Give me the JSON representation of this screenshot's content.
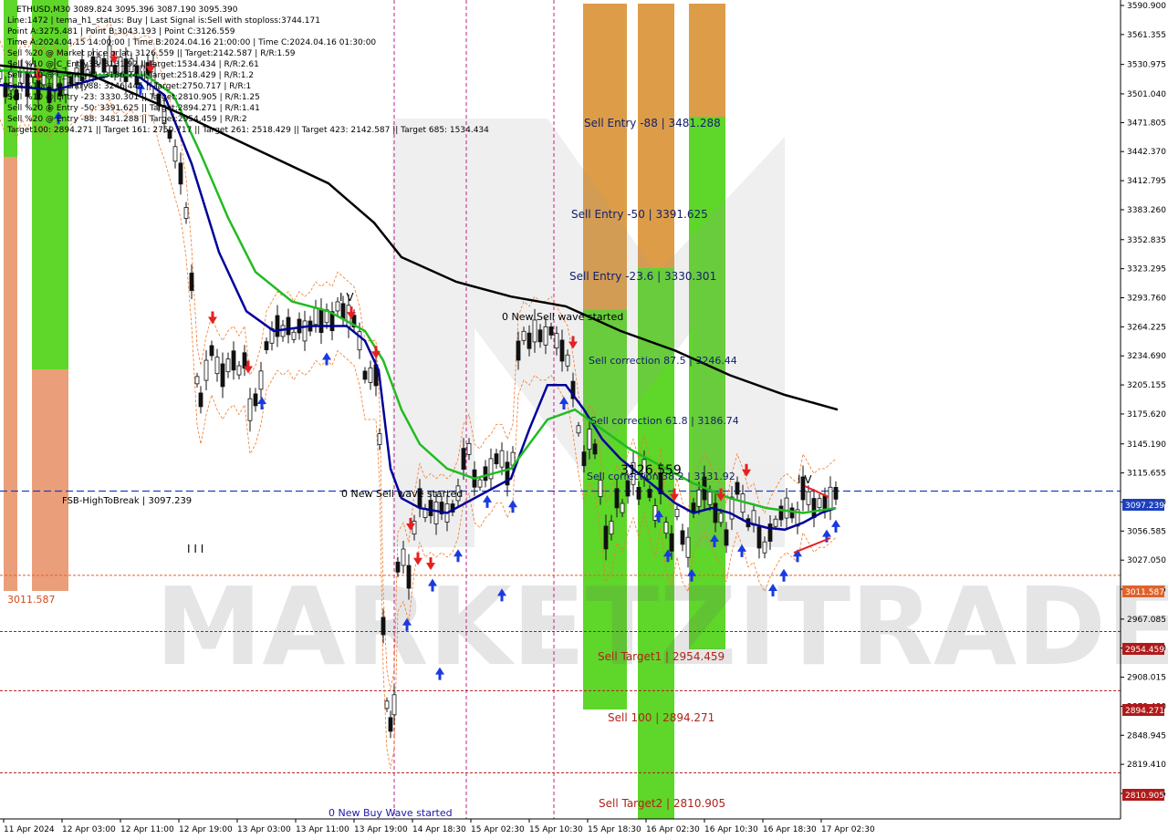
{
  "chart_data": {
    "type": "candlestick",
    "symbol_line": "ETHUSD,M30  3089.824 3095.396 3087.190 3095.390",
    "info_lines": [
      "Line:1472 | tema_h1_status: Buy | Last Signal is:Sell with stoploss:3744.171",
      "Point A:3275.481 | Point B:3043.193 | Point C:3126.559",
      "Time A:2024.04.15 14:00:00 | Time B:2024.04.16 21:00:00 | Time C:2024.04.16 01:30:00",
      "Sell %20 @ Market price or at: 3126.559 || Target:2142.587 | R/R:1.59",
      "Sell %10 @ C_Entry38: 3131.92 || Target:1534.434 | R/R:2.61",
      "Sell %10 @ C_Entry61: 3186.74 || Target:2518.429 | R/R:1.2",
      "Sell %10 @ C_Entry88: 3246.445 || Target:2750.717 | R/R:1",
      "Sell %10 @ Entry -23: 3330.301 || Target:2810.905 | R/R:1.25",
      "Sell %20 @ Entry -50: 3391.625 || Target:2894.271 | R/R:1.41",
      "Sell %20 @ Entry -88: 3481.288 || Target:2954.459 | R/R:2",
      "Target100: 2894.271 || Target 161: 2750.717 || Target 261: 2518.429 || Target 423: 2142.587 || Target 685: 1534.434"
    ],
    "y_ticks": [
      "3590.900",
      "3561.355",
      "3530.975",
      "3501.040",
      "3471.805",
      "3442.370",
      "3412.795",
      "3383.260",
      "3352.835",
      "3323.295",
      "3293.760",
      "3264.225",
      "3234.690",
      "3205.155",
      "3175.620",
      "3145.190",
      "3115.655",
      "3086.120",
      "3056.585",
      "3027.050",
      "2997.515",
      "2967.085",
      "2937.550",
      "2908.015",
      "2878.480",
      "2848.945",
      "2819.410",
      "2789.875"
    ],
    "x_ticks": [
      "11 Apr 2024",
      "12 Apr 03:00",
      "12 Apr 11:00",
      "12 Apr 19:00",
      "13 Apr 03:00",
      "13 Apr 11:00",
      "13 Apr 19:00",
      "14 Apr 18:30",
      "15 Apr 02:30",
      "15 Apr 10:30",
      "15 Apr 18:30",
      "16 Apr 02:30",
      "16 Apr 10:30",
      "16 Apr 18:30",
      "17 Apr 02:30"
    ],
    "y_range": [
      2785.0,
      3595.0
    ],
    "current_price": "3097.239",
    "level_labels": {
      "fsb_high": "FSB-HighToBreak | 3097.239",
      "level_3011_left": "3011.587",
      "level_3011_right": "3011.587",
      "level_2954": "2954.459",
      "level_2894": "2894.271",
      "level_2810": "2810.905"
    },
    "zone_labels": {
      "sell_entry_88": "Sell Entry -88 | 3481.288",
      "sell_entry_50": "Sell Entry -50 | 3391.625",
      "sell_entry_23": "Sell Entry -23.6 | 3330.301",
      "sell_corr_875": "Sell correction 87.5 | 3246.44",
      "sell_corr_618": "Sell correction 61.8 | 3186.74",
      "sell_corr_382": "Sell correction 38.2 | 3131.92",
      "point_c": "3126.559",
      "sell_target1": "Sell Target1 | 2954.459",
      "sell_100": "Sell 100 | 2894.271",
      "sell_target2": "Sell Target2 | 2810.905"
    },
    "annotations": {
      "new_sell_wave_1": "0 New Sell wave started",
      "new_sell_wave_2": "0 New Sell wave started",
      "new_buy_wave": "0 New Buy Wave started",
      "wave_iv_1": "I V",
      "wave_iii": "I I I",
      "wave_iv_2": "I V"
    },
    "watermark": "MARKETZITRADE",
    "series": [
      {
        "name": "price",
        "color": "#000000",
        "points": [
          [
            0,
            3520
          ],
          [
            6,
            3505
          ],
          [
            12,
            3515
          ],
          [
            18,
            3500
          ],
          [
            24,
            3520
          ],
          [
            30,
            3510
          ],
          [
            36,
            3525
          ],
          [
            42,
            3505
          ],
          [
            48,
            3515
          ],
          [
            54,
            3500
          ],
          [
            60,
            3515
          ],
          [
            66,
            3505
          ],
          [
            72,
            3510
          ],
          [
            78,
            3515
          ],
          [
            84,
            3520
          ],
          [
            90,
            3525
          ],
          [
            96,
            3520
          ],
          [
            102,
            3530
          ],
          [
            108,
            3535
          ],
          [
            114,
            3530
          ],
          [
            120,
            3540
          ],
          [
            126,
            3525
          ],
          [
            132,
            3530
          ],
          [
            138,
            3525
          ],
          [
            144,
            3530
          ],
          [
            150,
            3520
          ],
          [
            156,
            3525
          ],
          [
            162,
            3525
          ],
          [
            168,
            3520
          ],
          [
            174,
            3495
          ],
          [
            180,
            3480
          ],
          [
            186,
            3460
          ],
          [
            192,
            3440
          ],
          [
            198,
            3420
          ],
          [
            204,
            3380
          ],
          [
            210,
            3310
          ],
          [
            216,
            3210
          ],
          [
            220,
            3190
          ],
          [
            226,
            3220
          ],
          [
            232,
            3240
          ],
          [
            238,
            3225
          ],
          [
            244,
            3215
          ],
          [
            250,
            3225
          ],
          [
            256,
            3230
          ],
          [
            262,
            3220
          ],
          [
            268,
            3230
          ],
          [
            274,
            3180
          ],
          [
            280,
            3190
          ],
          [
            286,
            3210
          ],
          [
            292,
            3245
          ],
          [
            298,
            3255
          ],
          [
            304,
            3265
          ],
          [
            310,
            3260
          ],
          [
            316,
            3265
          ],
          [
            322,
            3255
          ],
          [
            328,
            3265
          ],
          [
            334,
            3260
          ],
          [
            340,
            3265
          ],
          [
            346,
            3275
          ],
          [
            352,
            3270
          ],
          [
            358,
            3275
          ],
          [
            364,
            3270
          ],
          [
            370,
            3285
          ],
          [
            376,
            3280
          ],
          [
            382,
            3275
          ],
          [
            388,
            3270
          ],
          [
            394,
            3250
          ],
          [
            400,
            3215
          ],
          [
            406,
            3215
          ],
          [
            412,
            3215
          ],
          [
            416,
            3150
          ],
          [
            420,
            2960
          ],
          [
            424,
            2880
          ],
          [
            428,
            2860
          ],
          [
            432,
            2880
          ],
          [
            436,
            3020
          ],
          [
            442,
            3030
          ],
          [
            448,
            3010
          ],
          [
            454,
            3060
          ],
          [
            460,
            3090
          ],
          [
            466,
            3075
          ],
          [
            472,
            3080
          ],
          [
            478,
            3075
          ],
          [
            484,
            3080
          ],
          [
            490,
            3075
          ],
          [
            496,
            3080
          ],
          [
            502,
            3095
          ],
          [
            508,
            3130
          ],
          [
            514,
            3140
          ],
          [
            520,
            3110
          ],
          [
            526,
            3105
          ],
          [
            532,
            3115
          ],
          [
            538,
            3120
          ],
          [
            544,
            3130
          ],
          [
            550,
            3130
          ],
          [
            556,
            3115
          ],
          [
            562,
            3130
          ],
          [
            568,
            3240
          ],
          [
            574,
            3255
          ],
          [
            580,
            3250
          ],
          [
            586,
            3260
          ],
          [
            592,
            3255
          ],
          [
            598,
            3255
          ],
          [
            604,
            3260
          ],
          [
            610,
            3250
          ],
          [
            616,
            3240
          ],
          [
            622,
            3230
          ],
          [
            628,
            3200
          ],
          [
            634,
            3160
          ],
          [
            640,
            3130
          ],
          [
            646,
            3150
          ],
          [
            652,
            3140
          ],
          [
            658,
            3100
          ],
          [
            664,
            3050
          ],
          [
            670,
            3060
          ],
          [
            676,
            3090
          ],
          [
            682,
            3080
          ],
          [
            688,
            3100
          ],
          [
            694,
            3115
          ],
          [
            700,
            3095
          ],
          [
            706,
            3120
          ],
          [
            712,
            3095
          ],
          [
            718,
            3075
          ],
          [
            724,
            3105
          ],
          [
            730,
            3060
          ],
          [
            736,
            3045
          ],
          [
            742,
            3075
          ],
          [
            748,
            3050
          ],
          [
            754,
            3040
          ],
          [
            760,
            3080
          ],
          [
            766,
            3090
          ],
          [
            772,
            3100
          ],
          [
            778,
            3090
          ],
          [
            784,
            3075
          ],
          [
            790,
            3070
          ],
          [
            796,
            3050
          ],
          [
            802,
            3080
          ],
          [
            808,
            3100
          ],
          [
            814,
            3085
          ],
          [
            820,
            3065
          ],
          [
            826,
            3070
          ],
          [
            832,
            3050
          ],
          [
            838,
            3040
          ],
          [
            844,
            3055
          ],
          [
            850,
            3065
          ],
          [
            856,
            3075
          ],
          [
            862,
            3080
          ],
          [
            868,
            3075
          ],
          [
            874,
            3070
          ],
          [
            880,
            3100
          ],
          [
            886,
            3090
          ],
          [
            892,
            3080
          ],
          [
            898,
            3085
          ],
          [
            904,
            3085
          ],
          [
            910,
            3090
          ],
          [
            916,
            3095
          ]
        ]
      },
      {
        "name": "fast",
        "color": "#00009a",
        "points": [
          [
            0,
            3510
          ],
          [
            60,
            3505
          ],
          [
            120,
            3520
          ],
          [
            150,
            3520
          ],
          [
            180,
            3500
          ],
          [
            210,
            3430
          ],
          [
            240,
            3340
          ],
          [
            270,
            3280
          ],
          [
            300,
            3260
          ],
          [
            340,
            3265
          ],
          [
            380,
            3265
          ],
          [
            400,
            3250
          ],
          [
            415,
            3220
          ],
          [
            428,
            3120
          ],
          [
            440,
            3090
          ],
          [
            460,
            3080
          ],
          [
            490,
            3075
          ],
          [
            510,
            3085
          ],
          [
            540,
            3100
          ],
          [
            560,
            3110
          ],
          [
            580,
            3160
          ],
          [
            600,
            3205
          ],
          [
            620,
            3205
          ],
          [
            640,
            3180
          ],
          [
            660,
            3150
          ],
          [
            680,
            3130
          ],
          [
            700,
            3115
          ],
          [
            720,
            3100
          ],
          [
            740,
            3085
          ],
          [
            760,
            3075
          ],
          [
            780,
            3080
          ],
          [
            800,
            3075
          ],
          [
            820,
            3065
          ],
          [
            840,
            3060
          ],
          [
            860,
            3058
          ],
          [
            880,
            3065
          ],
          [
            900,
            3075
          ],
          [
            916,
            3080
          ]
        ]
      },
      {
        "name": "mid",
        "color": "#22bb22",
        "points": [
          [
            0,
            3525
          ],
          [
            80,
            3520
          ],
          [
            160,
            3520
          ],
          [
            190,
            3500
          ],
          [
            220,
            3440
          ],
          [
            250,
            3375
          ],
          [
            280,
            3320
          ],
          [
            320,
            3290
          ],
          [
            360,
            3280
          ],
          [
            400,
            3260
          ],
          [
            420,
            3230
          ],
          [
            440,
            3180
          ],
          [
            460,
            3145
          ],
          [
            490,
            3120
          ],
          [
            520,
            3110
          ],
          [
            560,
            3120
          ],
          [
            600,
            3170
          ],
          [
            630,
            3180
          ],
          [
            660,
            3160
          ],
          [
            690,
            3140
          ],
          [
            720,
            3125
          ],
          [
            760,
            3105
          ],
          [
            800,
            3090
          ],
          [
            840,
            3080
          ],
          [
            880,
            3075
          ],
          [
            916,
            3080
          ]
        ]
      },
      {
        "name": "slow",
        "color": "#000000",
        "points": [
          [
            0,
            3530
          ],
          [
            100,
            3520
          ],
          [
            200,
            3480
          ],
          [
            280,
            3445
          ],
          [
            360,
            3410
          ],
          [
            410,
            3370
          ],
          [
            440,
            3335
          ],
          [
            500,
            3310
          ],
          [
            560,
            3295
          ],
          [
            620,
            3285
          ],
          [
            680,
            3260
          ],
          [
            740,
            3240
          ],
          [
            800,
            3215
          ],
          [
            860,
            3195
          ],
          [
            918,
            3180
          ]
        ]
      }
    ],
    "arrows_down": [
      [
        42,
        3512
      ],
      [
        125,
        3530
      ],
      [
        165,
        3520
      ],
      [
        233,
        3265
      ],
      [
        272,
        3215
      ],
      [
        385,
        3270
      ],
      [
        412,
        3230
      ],
      [
        450,
        3055
      ],
      [
        458,
        3020
      ],
      [
        472,
        3015
      ],
      [
        628,
        3240
      ],
      [
        739,
        3085
      ],
      [
        790,
        3085
      ],
      [
        818,
        3110
      ]
    ],
    "arrows_up": [
      [
        64,
        3485
      ],
      [
        154,
        3515
      ],
      [
        287,
        3195
      ],
      [
        358,
        3240
      ],
      [
        474,
        3010
      ],
      [
        446,
        2970
      ],
      [
        482,
        2920
      ],
      [
        502,
        3040
      ],
      [
        534,
        3095
      ],
      [
        550,
        3000
      ],
      [
        562,
        3090
      ],
      [
        618,
        3195
      ],
      [
        722,
        3080
      ],
      [
        732,
        3040
      ],
      [
        758,
        3020
      ],
      [
        783,
        3055
      ],
      [
        813,
        3045
      ],
      [
        847,
        3005
      ],
      [
        859,
        3020
      ],
      [
        874,
        3040
      ],
      [
        906,
        3060
      ],
      [
        916,
        3070
      ]
    ]
  }
}
